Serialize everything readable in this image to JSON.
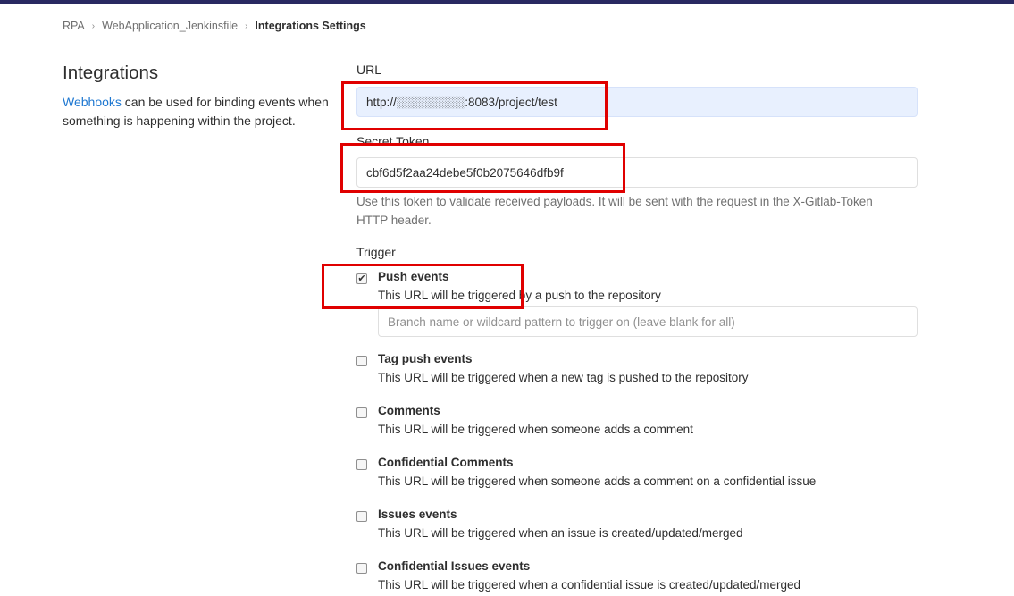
{
  "breadcrumb": {
    "items": [
      "RPA",
      "WebApplication_Jenkinsfile"
    ],
    "current": "Integrations Settings",
    "separator": "›"
  },
  "sidebar": {
    "title": "Integrations",
    "link_text": "Webhooks",
    "description": "can be used for binding events when something is happening within the project."
  },
  "form": {
    "url_label": "URL",
    "url_value": "http://░░░░░░░░:8083/project/test",
    "token_label": "Secret Token",
    "token_value": "cbf6d5f2aa24debe5f0b2075646dfb9f",
    "token_help": "Use this token to validate received payloads. It will be sent with the request in the X-Gitlab-Token HTTP header.",
    "trigger_label": "Trigger",
    "branch_placeholder": "Branch name or wildcard pattern to trigger on (leave blank for all)"
  },
  "events": [
    {
      "title": "Push events",
      "desc": "This URL will be triggered by a push to the repository",
      "checked": true
    },
    {
      "title": "Tag push events",
      "desc": "This URL will be triggered when a new tag is pushed to the repository",
      "checked": false
    },
    {
      "title": "Comments",
      "desc": "This URL will be triggered when someone adds a comment",
      "checked": false
    },
    {
      "title": "Confidential Comments",
      "desc": "This URL will be triggered when someone adds a comment on a confidential issue",
      "checked": false
    },
    {
      "title": "Issues events",
      "desc": "This URL will be triggered when an issue is created/updated/merged",
      "checked": false
    },
    {
      "title": "Confidential Issues events",
      "desc": "This URL will be triggered when a confidential issue is created/updated/merged",
      "checked": false
    }
  ],
  "colors": {
    "link": "#1f78d1",
    "annotation_box": "#e00000",
    "autofill_bg": "#e8f0fe",
    "topbar": "#292961"
  },
  "icons": {
    "breadcrumb_separator": "chevron-right-icon",
    "checkmark": "check-icon"
  }
}
